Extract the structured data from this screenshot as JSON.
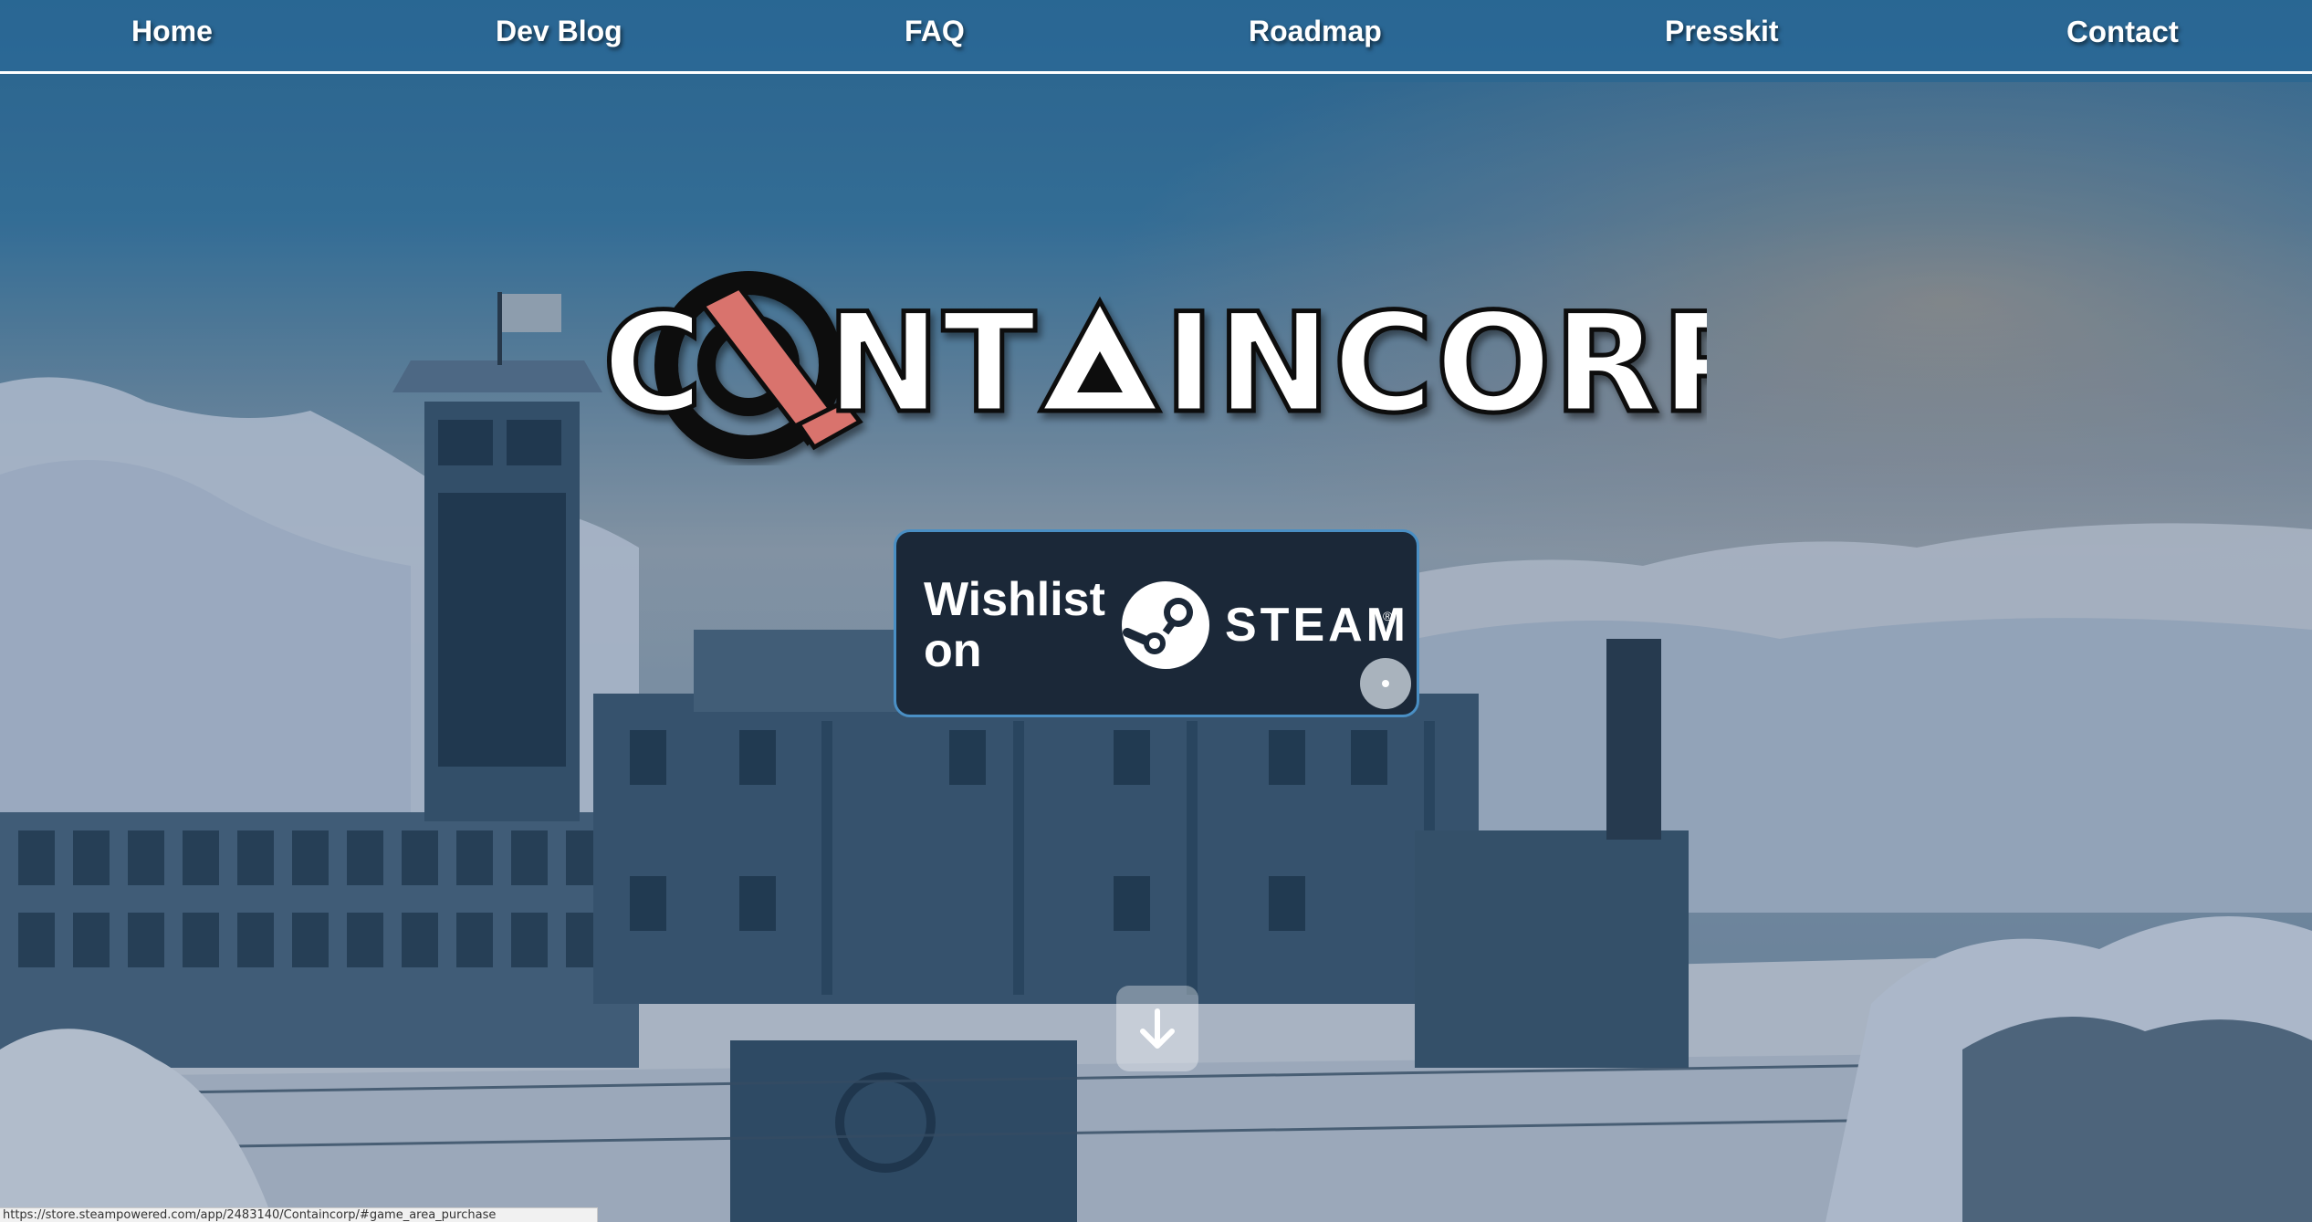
{
  "nav": {
    "items": [
      {
        "label": "Home"
      },
      {
        "label": "Dev Blog"
      },
      {
        "label": "FAQ"
      },
      {
        "label": "Roadmap"
      },
      {
        "label": "Presskit"
      },
      {
        "label": "Contact"
      }
    ]
  },
  "logo": {
    "text": "CONTAINCORP",
    "accent_color": "#d9736d"
  },
  "wishlist": {
    "label": "Wishlist on",
    "platform": "STEAM",
    "registered_mark": "®"
  },
  "scroll_button": {
    "icon": "arrow-down-icon"
  },
  "status_bar": {
    "url": "https://store.steampowered.com/app/2483140/Containcorp/#game_area_purchase"
  },
  "colors": {
    "nav_text": "#ffffff",
    "steam_bg": "#1b2838",
    "steam_border": "#4a8fc4"
  }
}
